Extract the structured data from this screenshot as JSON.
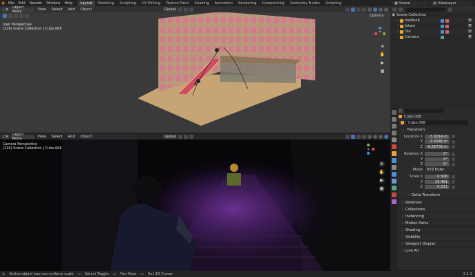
{
  "topbar": {
    "menus": [
      "File",
      "Edit",
      "Render",
      "Window",
      "Help"
    ],
    "workspaces": [
      "Layout",
      "Modeling",
      "Sculpting",
      "UV Editing",
      "Texture Paint",
      "Shading",
      "Animation",
      "Rendering",
      "Compositing",
      "Geometry Nodes",
      "Scripting"
    ],
    "active_workspace": "Layout",
    "scene": "Scene",
    "view_layer": "ViewLayer"
  },
  "viewport_top": {
    "mode": "Object Mode",
    "menus": [
      "View",
      "Select",
      "Add",
      "Object"
    ],
    "transform": "Global",
    "perspective": "User Perspective",
    "collection": "(216) Scene Collection | Cube.008",
    "options": "Options"
  },
  "viewport_bottom": {
    "mode": "Object Mode",
    "menus": [
      "View",
      "Select",
      "Add",
      "Object"
    ],
    "transform": "Global",
    "perspective": "Camera Perspective",
    "collection": "(216) Scene Collection | Cube.008"
  },
  "outliner": {
    "root": "Scene Collection",
    "items": [
      {
        "name": "meNoob",
        "color": "#e8a33a"
      },
      {
        "name": "Jotaro",
        "color": "#e8a33a"
      },
      {
        "name": "Dio",
        "color": "#e8a33a"
      },
      {
        "name": "Camera",
        "color": "#e8a33a"
      }
    ]
  },
  "properties": {
    "object_name": "Cube.008",
    "data_name": "Cube.008",
    "transform_label": "Transform",
    "location_label": "Location X",
    "location": [
      "-5.0214 m",
      "-5.5046 m",
      "-0.55735 m"
    ],
    "rotation_label": "Rotation X",
    "rotation": [
      "0°",
      "0°",
      "0°"
    ],
    "mode_label": "Mode",
    "mode_value": "XYZ Euler",
    "scale_label": "Scale X",
    "scale": [
      "0.506",
      "13.401",
      "0.231"
    ],
    "axis_y": "Y",
    "axis_z": "Z",
    "delta_transform": "Delta Transform",
    "panels": [
      "Relations",
      "Collections",
      "Instancing",
      "Motion Paths",
      "Shading",
      "Visibility",
      "Viewport Display",
      "Line Art"
    ]
  },
  "status": {
    "warning": "Active object has non-uniform scale",
    "select": "Select Toggle",
    "pan": "Pan View",
    "cursor": "Set 3D Cursor",
    "version": "3.1.1"
  }
}
